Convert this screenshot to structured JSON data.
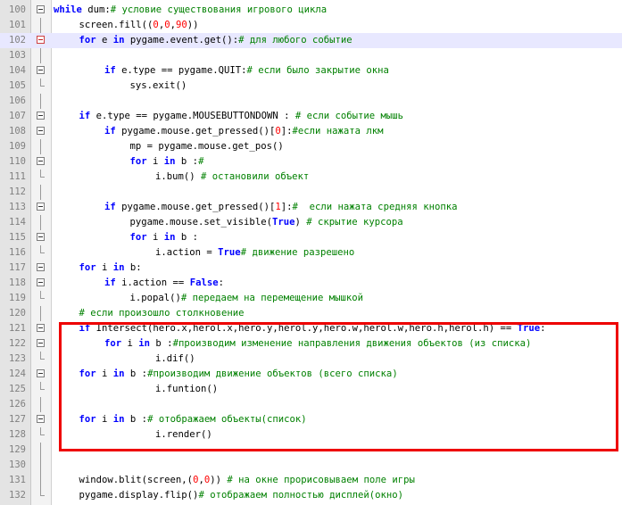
{
  "editor": {
    "lines": [
      {
        "n": "100",
        "indent": 0,
        "fold": "open",
        "tokens": [
          {
            "t": "while",
            "c": "kw"
          },
          {
            "t": " dum:",
            "c": ""
          },
          {
            "t": "# условие существования игрового цикла",
            "c": "cm"
          }
        ]
      },
      {
        "n": "101",
        "indent": 1,
        "fold": "line",
        "tokens": [
          {
            "t": "screen.fill((",
            "c": ""
          },
          {
            "t": "0",
            "c": "num"
          },
          {
            "t": ",",
            "c": ""
          },
          {
            "t": "0",
            "c": "num"
          },
          {
            "t": ",",
            "c": ""
          },
          {
            "t": "90",
            "c": "num"
          },
          {
            "t": "))",
            "c": ""
          }
        ]
      },
      {
        "n": "102",
        "indent": 1,
        "fold": "open-red",
        "hl": true,
        "tokens": [
          {
            "t": "for",
            "c": "kw"
          },
          {
            "t": " e ",
            "c": ""
          },
          {
            "t": "in",
            "c": "kw"
          },
          {
            "t": " pygame.event.get():",
            "c": ""
          },
          {
            "t": "# для любого событие",
            "c": "cm"
          }
        ]
      },
      {
        "n": "103",
        "indent": 0,
        "fold": "line",
        "tokens": []
      },
      {
        "n": "104",
        "indent": 2,
        "fold": "open",
        "tokens": [
          {
            "t": "if",
            "c": "kw"
          },
          {
            "t": " e.type == pygame.QUIT:",
            "c": ""
          },
          {
            "t": "# если было закрытие окна",
            "c": "cm"
          }
        ]
      },
      {
        "n": "105",
        "indent": 3,
        "fold": "end",
        "tokens": [
          {
            "t": "sys.exit()",
            "c": ""
          }
        ]
      },
      {
        "n": "106",
        "indent": 0,
        "fold": "line",
        "tokens": []
      },
      {
        "n": "107",
        "indent": 1,
        "fold": "open",
        "tokens": [
          {
            "t": "if",
            "c": "kw"
          },
          {
            "t": " e.type == pygame.MOUSEBUTTONDOWN : ",
            "c": ""
          },
          {
            "t": "# если событие мышь",
            "c": "cm"
          }
        ]
      },
      {
        "n": "108",
        "indent": 2,
        "fold": "open",
        "tokens": [
          {
            "t": "if",
            "c": "kw"
          },
          {
            "t": " pygame.mouse.get_pressed()[",
            "c": ""
          },
          {
            "t": "0",
            "c": "num"
          },
          {
            "t": "]:",
            "c": ""
          },
          {
            "t": "#если нажата лкм",
            "c": "cm"
          }
        ]
      },
      {
        "n": "109",
        "indent": 3,
        "fold": "line",
        "tokens": [
          {
            "t": "mp = pygame.mouse.get_pos()",
            "c": ""
          }
        ]
      },
      {
        "n": "110",
        "indent": 3,
        "fold": "open",
        "tokens": [
          {
            "t": "for",
            "c": "kw"
          },
          {
            "t": " i ",
            "c": ""
          },
          {
            "t": "in",
            "c": "kw"
          },
          {
            "t": " b :",
            "c": ""
          },
          {
            "t": "#",
            "c": "cm"
          }
        ]
      },
      {
        "n": "111",
        "indent": 4,
        "fold": "end",
        "tokens": [
          {
            "t": "i.bum() ",
            "c": ""
          },
          {
            "t": "# остановили объект",
            "c": "cm"
          }
        ]
      },
      {
        "n": "112",
        "indent": 0,
        "fold": "line",
        "tokens": []
      },
      {
        "n": "113",
        "indent": 2,
        "fold": "open",
        "tokens": [
          {
            "t": "if",
            "c": "kw"
          },
          {
            "t": " pygame.mouse.get_pressed()[",
            "c": ""
          },
          {
            "t": "1",
            "c": "num"
          },
          {
            "t": "]:",
            "c": ""
          },
          {
            "t": "#  если нажата средняя кнопка",
            "c": "cm"
          }
        ]
      },
      {
        "n": "114",
        "indent": 3,
        "fold": "line",
        "tokens": [
          {
            "t": "pygame.mouse.set_visible(",
            "c": ""
          },
          {
            "t": "True",
            "c": "kw"
          },
          {
            "t": ") ",
            "c": ""
          },
          {
            "t": "# скрытие курсора",
            "c": "cm"
          }
        ]
      },
      {
        "n": "115",
        "indent": 3,
        "fold": "open",
        "tokens": [
          {
            "t": "for",
            "c": "kw"
          },
          {
            "t": " i ",
            "c": ""
          },
          {
            "t": "in",
            "c": "kw"
          },
          {
            "t": " b :",
            "c": ""
          }
        ]
      },
      {
        "n": "116",
        "indent": 4,
        "fold": "end",
        "tokens": [
          {
            "t": "i.action = ",
            "c": ""
          },
          {
            "t": "True",
            "c": "kw"
          },
          {
            "t": "# движение разрешено",
            "c": "cm"
          }
        ]
      },
      {
        "n": "117",
        "indent": 1,
        "fold": "open",
        "tokens": [
          {
            "t": "for",
            "c": "kw"
          },
          {
            "t": " i ",
            "c": ""
          },
          {
            "t": "in",
            "c": "kw"
          },
          {
            "t": " b:",
            "c": ""
          }
        ]
      },
      {
        "n": "118",
        "indent": 2,
        "fold": "open",
        "tokens": [
          {
            "t": "if",
            "c": "kw"
          },
          {
            "t": " i.action == ",
            "c": ""
          },
          {
            "t": "False",
            "c": "kw"
          },
          {
            "t": ":",
            "c": ""
          }
        ]
      },
      {
        "n": "119",
        "indent": 3,
        "fold": "end",
        "tokens": [
          {
            "t": "i.popal()",
            "c": ""
          },
          {
            "t": "# передаем на перемещение мышкой",
            "c": "cm"
          }
        ]
      },
      {
        "n": "120",
        "indent": 1,
        "fold": "line",
        "tokens": [
          {
            "t": "# если произошло столкновение",
            "c": "cm"
          }
        ]
      },
      {
        "n": "121",
        "indent": 1,
        "fold": "open",
        "tokens": [
          {
            "t": "if",
            "c": "kw"
          },
          {
            "t": " Intersect(hero.x,herol.x,hero.y,herol.y,hero.w,herol.w,hero.h,herol.h) == ",
            "c": ""
          },
          {
            "t": "True",
            "c": "kw"
          },
          {
            "t": ":",
            "c": ""
          }
        ]
      },
      {
        "n": "122",
        "indent": 2,
        "fold": "open",
        "tokens": [
          {
            "t": "for",
            "c": "kw"
          },
          {
            "t": " i ",
            "c": ""
          },
          {
            "t": "in",
            "c": "kw"
          },
          {
            "t": " b :",
            "c": ""
          },
          {
            "t": "#производим изменение направления движения объектов (из списка)",
            "c": "cm"
          }
        ]
      },
      {
        "n": "123",
        "indent": 4,
        "fold": "end",
        "tokens": [
          {
            "t": "i.dif()",
            "c": ""
          }
        ]
      },
      {
        "n": "124",
        "indent": 1,
        "fold": "open",
        "tokens": [
          {
            "t": "for",
            "c": "kw"
          },
          {
            "t": " i ",
            "c": ""
          },
          {
            "t": "in",
            "c": "kw"
          },
          {
            "t": " b :",
            "c": ""
          },
          {
            "t": "#производим движение объектов (всего списка)",
            "c": "cm"
          }
        ]
      },
      {
        "n": "125",
        "indent": 4,
        "fold": "end",
        "tokens": [
          {
            "t": "i.funtion()",
            "c": ""
          }
        ]
      },
      {
        "n": "126",
        "indent": 0,
        "fold": "line",
        "tokens": []
      },
      {
        "n": "127",
        "indent": 1,
        "fold": "open",
        "tokens": [
          {
            "t": "for",
            "c": "kw"
          },
          {
            "t": " i ",
            "c": ""
          },
          {
            "t": "in",
            "c": "kw"
          },
          {
            "t": " b :",
            "c": ""
          },
          {
            "t": "# отображаем объекты(список)",
            "c": "cm"
          }
        ]
      },
      {
        "n": "128",
        "indent": 4,
        "fold": "end",
        "tokens": [
          {
            "t": "i.render()",
            "c": ""
          }
        ]
      },
      {
        "n": "129",
        "indent": 0,
        "fold": "line",
        "tokens": []
      },
      {
        "n": "130",
        "indent": 0,
        "fold": "line",
        "tokens": []
      },
      {
        "n": "131",
        "indent": 1,
        "fold": "line",
        "tokens": [
          {
            "t": "window.blit(screen,(",
            "c": ""
          },
          {
            "t": "0",
            "c": "num"
          },
          {
            "t": ",",
            "c": ""
          },
          {
            "t": "0",
            "c": "num"
          },
          {
            "t": ")) ",
            "c": ""
          },
          {
            "t": "# на окне прорисовываем поле игры",
            "c": "cm"
          }
        ]
      },
      {
        "n": "132",
        "indent": 1,
        "fold": "end",
        "tokens": [
          {
            "t": "pygame.display.flip()",
            "c": ""
          },
          {
            "t": "# отображаем полностью дисплей(окно)",
            "c": "cm"
          }
        ]
      }
    ]
  },
  "colors": {
    "keyword": "#0000ff",
    "number": "#ff0000",
    "comment": "#008000",
    "highlight_box": "#ee0000",
    "current_line": "#e8e8ff"
  }
}
